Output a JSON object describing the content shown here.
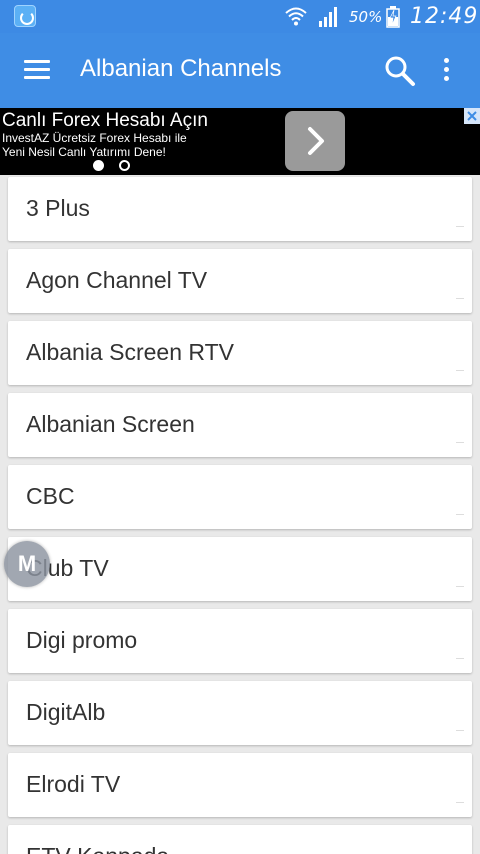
{
  "status_bar": {
    "battery_percent": "50%",
    "time": "12:49",
    "icons": [
      "app-notification-icon",
      "wifi-icon",
      "signal-icon",
      "battery-charging-icon"
    ]
  },
  "app_bar": {
    "title": "Albanian Channels",
    "icons": [
      "menu-icon",
      "search-icon",
      "overflow-icon"
    ],
    "color": "#3f8de5"
  },
  "ad": {
    "title": "Canlı Forex Hesabı Açın",
    "line1": "InvestAZ Ücretsiz Forex Hesabı ile",
    "line2": "Yeni Nesil Canlı Yatırımı Dene!",
    "icons": [
      "chevron-right-icon",
      "ad-info-icon"
    ]
  },
  "channels": [
    {
      "label": "3 Plus"
    },
    {
      "label": "Agon Channel TV"
    },
    {
      "label": "Albania Screen RTV"
    },
    {
      "label": "Albanian Screen"
    },
    {
      "label": "CBC"
    },
    {
      "label": "Club TV"
    },
    {
      "label": "Digi promo"
    },
    {
      "label": "DigitAlb"
    },
    {
      "label": "Elrodi TV"
    },
    {
      "label": "ETV Kanpada"
    }
  ],
  "floating_bubble": {
    "letter": "M"
  }
}
